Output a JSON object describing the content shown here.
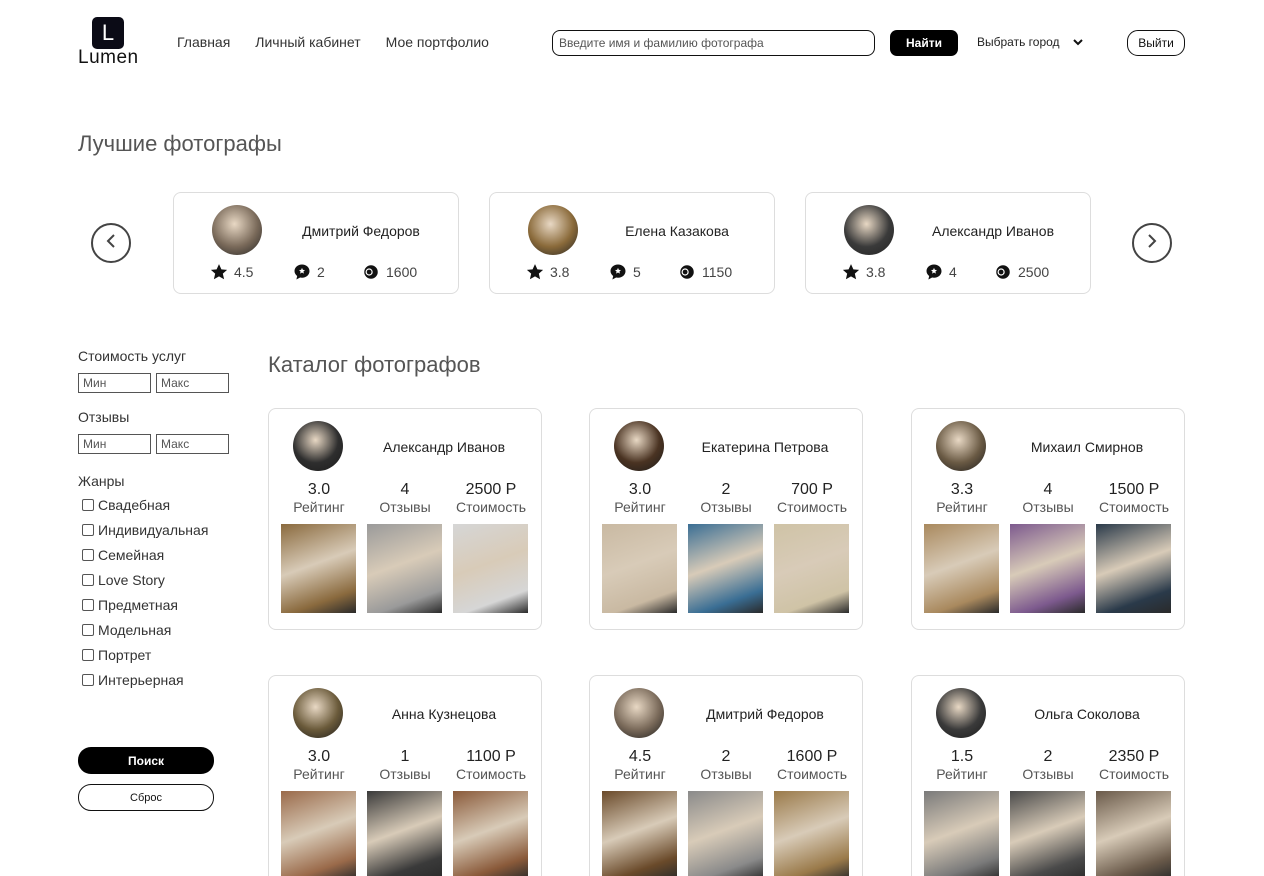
{
  "header": {
    "logo_letter": "L",
    "logo_text": "Lumen",
    "nav": [
      "Главная",
      "Личный кабинет",
      "Мое портфолио"
    ],
    "search_placeholder": "Введите имя и фамилию фотографа",
    "find_label": "Найти",
    "city_label": "Выбрать город",
    "logout_label": "Выйти"
  },
  "top": {
    "title": "Лучшие фотографы",
    "cards": [
      {
        "name": "Дмитрий Федоров",
        "rating": "4.5",
        "reviews": "2",
        "coins": "1600",
        "avatar_color": "#7a6a5a"
      },
      {
        "name": "Елена Казакова",
        "rating": "3.8",
        "reviews": "5",
        "coins": "1150",
        "avatar_color": "#8a6a3a"
      },
      {
        "name": "Александр Иванов",
        "rating": "3.8",
        "reviews": "4",
        "coins": "2500",
        "avatar_color": "#3a3a3a"
      }
    ]
  },
  "filters": {
    "price_label": "Стоимость услуг",
    "reviews_label": "Отзывы",
    "min_placeholder": "Мин",
    "max_placeholder": "Макс",
    "genres_label": "Жанры",
    "genres": [
      "Свадебная",
      "Индивидуальная",
      "Семейная",
      "Love Story",
      "Предметная",
      "Модельная",
      "Портрет",
      "Интерьерная"
    ],
    "search_label": "Поиск",
    "reset_label": "Сброс"
  },
  "catalog": {
    "title": "Каталог фотографов",
    "rating_label": "Рейтинг",
    "reviews_label": "Отзывы",
    "price_label": "Стоимость",
    "cards": [
      {
        "name": "Александр Иванов",
        "rating": "3.0",
        "reviews": "4",
        "price": "2500 Р",
        "avatar_color": "#2e2e2e",
        "photos": [
          "#8a6a3e",
          "#9a9a9a",
          "#d6d6d6"
        ]
      },
      {
        "name": "Екатерина Петрова",
        "rating": "3.0",
        "reviews": "2",
        "price": "700 Р",
        "avatar_color": "#4a3322",
        "photos": [
          "#c9b9a2",
          "#3a6e94",
          "#cfc3a6"
        ]
      },
      {
        "name": "Михаил Смирнов",
        "rating": "3.3",
        "reviews": "4",
        "price": "1500 Р",
        "avatar_color": "#6a5a44",
        "photos": [
          "#a9895e",
          "#7d5a8e",
          "#2a3a4a"
        ]
      },
      {
        "name": "Анна Кузнецова",
        "rating": "3.0",
        "reviews": "1",
        "price": "1100 Р",
        "avatar_color": "#6a5a3a",
        "photos": [
          "#9a6a4a",
          "#3a3a3a",
          "#8a5a3a"
        ]
      },
      {
        "name": "Дмитрий Федоров",
        "rating": "4.5",
        "reviews": "2",
        "price": "1600 Р",
        "avatar_color": "#7a6a5a",
        "photos": [
          "#6a4a2a",
          "#8a8a8a",
          "#9a7a4a"
        ]
      },
      {
        "name": "Ольга Соколова",
        "rating": "1.5",
        "reviews": "2",
        "price": "2350 Р",
        "avatar_color": "#3a3a3a",
        "photos": [
          "#7a7a7a",
          "#4a4a4a",
          "#6a5a4a"
        ]
      }
    ]
  }
}
